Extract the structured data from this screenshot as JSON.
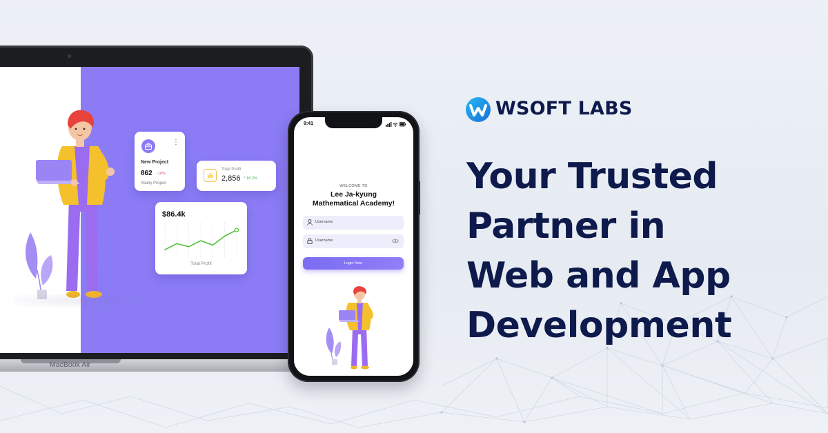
{
  "brand": {
    "name": "WSOFT LABS",
    "colors": {
      "navy": "#0e1a4b",
      "purple": "#8b7cf6",
      "logo_blue": "#1aa7ec"
    }
  },
  "headline": {
    "lines": [
      "Your Trusted",
      "Partner in",
      "Web and App",
      "Development"
    ]
  },
  "laptop": {
    "label": "MacBook Air",
    "project_card": {
      "icon": "briefcase-icon",
      "title": "New Project",
      "value": "862",
      "change": "-18%",
      "subtitle": "Yearly Project"
    },
    "profit_card": {
      "icon": "bar-chart-icon",
      "label": "Total Profit",
      "value": "2,856",
      "change": "18.2%"
    },
    "chart_card": {
      "value": "$86.4k",
      "caption": "Total Profit"
    }
  },
  "phone": {
    "time": "9:41",
    "welcome": "WELCOME TO",
    "brand_line_1": "Lee Ja-kyung",
    "brand_line_2": "Mathematical Academy!",
    "field_1_placeholder": "Username",
    "field_2_placeholder": "Username",
    "login_label": "Login Now"
  },
  "chart_data": {
    "type": "line",
    "x": [
      0,
      1,
      2,
      3,
      4,
      5,
      6
    ],
    "values": [
      2,
      4,
      3,
      5,
      3.5,
      6.5,
      8.5
    ],
    "ylim": [
      0,
      10
    ],
    "title": "$86.4k",
    "xlabel": "Total Profit",
    "ylabel": ""
  }
}
